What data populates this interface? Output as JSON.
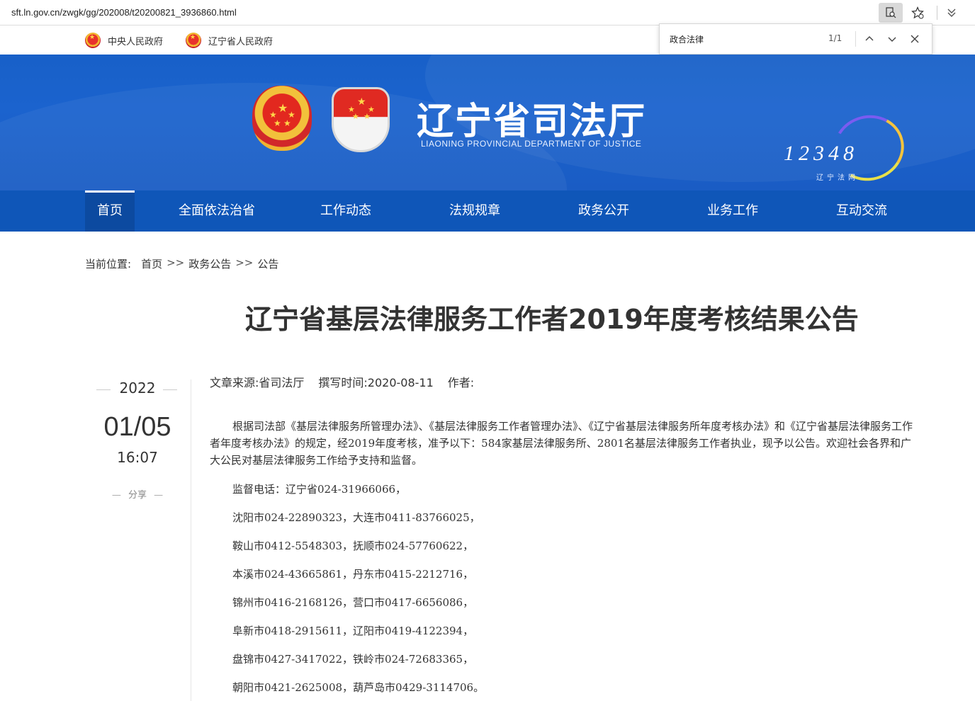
{
  "browser": {
    "url": "sft.ln.gov.cn/zwgk/gg/202008/t20200821_3936860.html"
  },
  "findbar": {
    "query": "政合法律",
    "count": "1/1"
  },
  "toplinks": [
    {
      "label": "中央人民政府"
    },
    {
      "label": "辽宁省人民政府"
    }
  ],
  "banner": {
    "title_cn": "辽宁省司法厅",
    "title_en": "LIAONING PROVINCIAL DEPARTMENT OF JUSTICE",
    "logo_number": "12348",
    "logo_sub": "辽宁法网"
  },
  "nav": [
    {
      "label": "首页",
      "active": true
    },
    {
      "label": "全面依法治省"
    },
    {
      "label": "工作动态"
    },
    {
      "label": "法规规章"
    },
    {
      "label": "政务公开"
    },
    {
      "label": "业务工作"
    },
    {
      "label": "互动交流"
    }
  ],
  "breadcrumb": {
    "prefix": "当前位置:",
    "items": [
      "首页",
      "政务公告",
      "公告"
    ],
    "separator": ">>"
  },
  "article": {
    "title": "辽宁省基层法律服务工作者2019年度考核结果公告",
    "date_year": "2022",
    "date_md": "01/05",
    "date_time": "16:07",
    "share_label": "分享",
    "source": "文章来源:省司法厅",
    "written": "撰写时间:2020-08-11",
    "author": "作者:",
    "paragraph": "根据司法部《基层法律服务所管理办法》、《基层法律服务工作者管理办法》、《辽宁省基层法律服务所年度考核办法》和《辽宁省基层法律服务工作者年度考核办法》的规定，经2019年度考核，准予以下：584家基层法律服务所、2801名基层法律服务工作者执业，现予以公告。欢迎社会各界和广大公民对基层法律服务工作给予支持和监督。",
    "lines": [
      "监督电话：辽宁省024-31966066，",
      "沈阳市024-22890323，大连市0411-83766025，",
      "鞍山市0412-5548303，抚顺市024-57760622，",
      "本溪市024-43665861，丹东市0415-2212716，",
      "锦州市0416-2168126，营口市0417-6656086，",
      "阜新市0418-2915611，辽阳市0419-4122394，",
      "盘锦市0427-3417022，铁岭市024-72683365，",
      "朝阳市0421-2625008，葫芦岛市0429-3114706。"
    ]
  }
}
